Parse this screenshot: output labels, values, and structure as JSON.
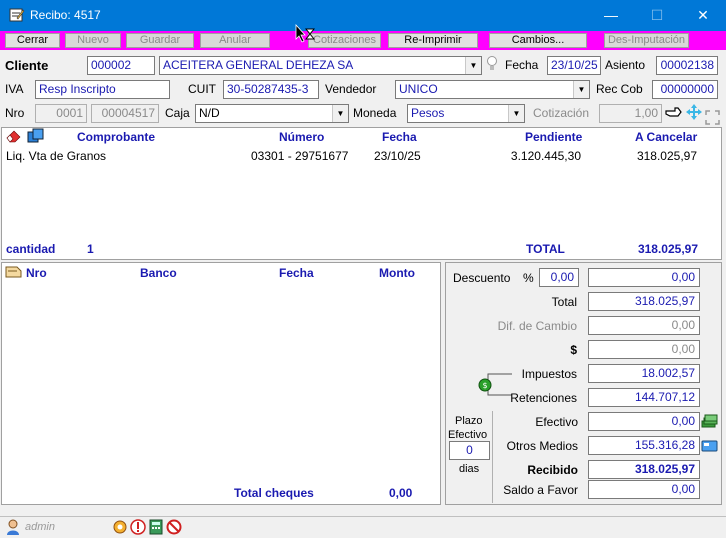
{
  "window": {
    "title": "Recibo: 4517"
  },
  "toolbar": {
    "cerrar": "Cerrar",
    "nuevo": "Nuevo",
    "guardar": "Guardar",
    "anular": "Anular",
    "cotizaciones": "Cotizaciones",
    "reimprimir": "Re-Imprimir",
    "cambios": "Cambios...",
    "desimputacion": "Des-Imputación"
  },
  "header": {
    "cliente_label": "Cliente",
    "cliente_code": "000002",
    "cliente_name": "ACEITERA GENERAL DEHEZA SA",
    "fecha_label": "Fecha",
    "fecha": "23/10/25",
    "asiento_label": "Asiento",
    "asiento": "00002138",
    "iva_label": "IVA",
    "iva": "Resp Inscripto",
    "cuit_label": "CUIT",
    "cuit": "30-50287435-3",
    "vendedor_label": "Vendedor",
    "vendedor": "UNICO",
    "reccob_label": "Rec Cob",
    "reccob": "00000000",
    "nro_label": "Nro",
    "nro_pv": "0001",
    "nro_num": "00004517",
    "caja_label": "Caja",
    "caja": "N/D",
    "moneda_label": "Moneda",
    "moneda": "Pesos",
    "cotizacion_label": "Cotización",
    "cotizacion": "1,00"
  },
  "comprobantes": {
    "columns": {
      "comprobante": "Comprobante",
      "numero": "Número",
      "fecha": "Fecha",
      "pendiente": "Pendiente",
      "acancelar": "A Cancelar"
    },
    "rows": [
      {
        "comprobante": "Liq. Vta de Granos",
        "numero": "03301 - 29751677",
        "fecha": "23/10/25",
        "pendiente": "3.120.445,30",
        "acancelar": "318.025,97"
      }
    ],
    "cantidad_label": "cantidad",
    "cantidad": "1",
    "total_label": "TOTAL",
    "total": "318.025,97"
  },
  "cheques": {
    "columns": {
      "nro": "Nro",
      "banco": "Banco",
      "fecha": "Fecha",
      "monto": "Monto"
    },
    "total_label": "Total cheques",
    "total": "0,00"
  },
  "resumen": {
    "descuento_label": "Descuento",
    "pct": "%",
    "descuento_pct": "0,00",
    "descuento": "0,00",
    "total_label": "Total",
    "total": "318.025,97",
    "difcambio_label": "Dif. de Cambio",
    "difcambio": "0,00",
    "pesos_label": "$",
    "pesos": "0,00",
    "impuestos_label": "Impuestos",
    "impuestos": "18.002,57",
    "retenciones_label": "Retenciones",
    "retenciones": "144.707,12",
    "plazo_label": "Plazo",
    "efectivo_plazo_label": "Efectivo",
    "plazo_dias": "0",
    "dias_label": "dias",
    "efectivo_label": "Efectivo",
    "efectivo": "0,00",
    "otros_label": "Otros Medios",
    "otros": "155.316,28",
    "recibido_label": "Recibido",
    "recibido": "318.025,97",
    "saldo_label": "Saldo a Favor",
    "saldo": "0,00"
  },
  "status": {
    "user": "admin"
  }
}
